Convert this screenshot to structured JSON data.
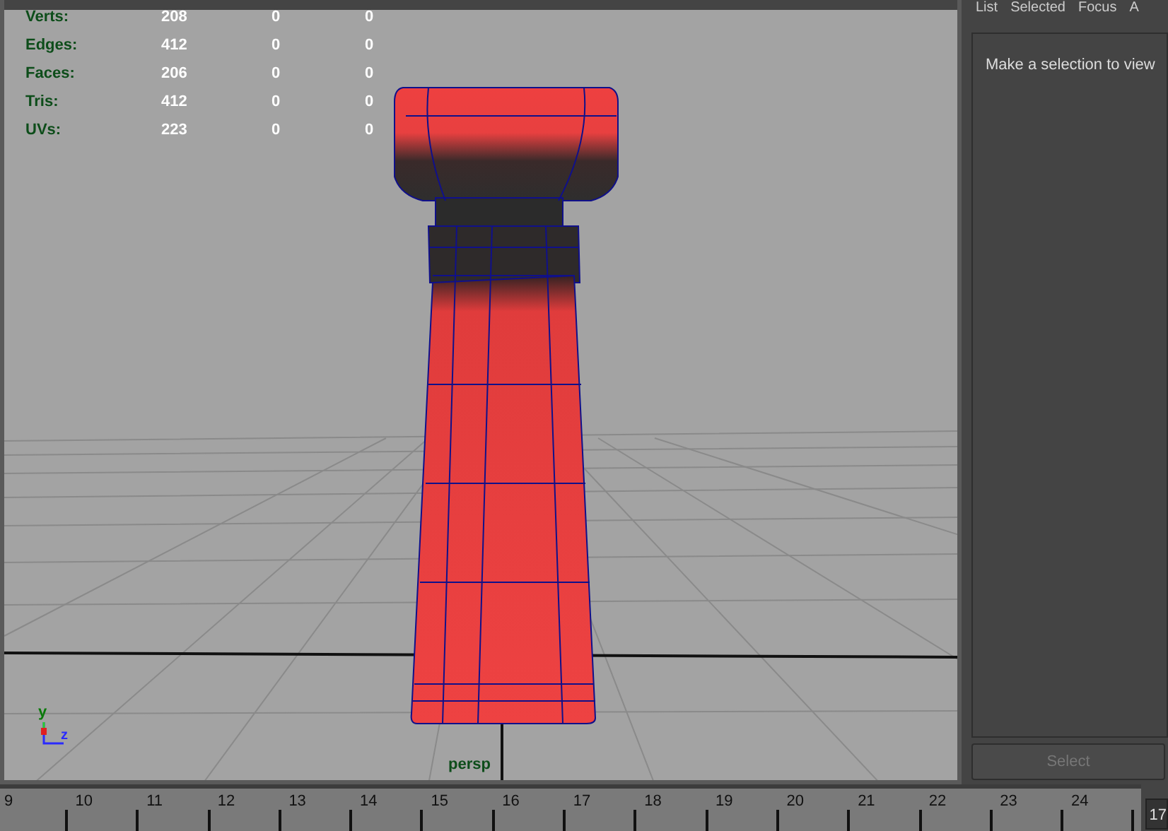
{
  "viewport": {
    "stats": [
      {
        "label": "Verts:",
        "values": [
          "208",
          "0",
          "0"
        ]
      },
      {
        "label": "Edges:",
        "values": [
          "412",
          "0",
          "0"
        ]
      },
      {
        "label": "Faces:",
        "values": [
          "206",
          "0",
          "0"
        ]
      },
      {
        "label": "Tris:",
        "values": [
          "412",
          "0",
          "0"
        ]
      },
      {
        "label": "UVs:",
        "values": [
          "223",
          "0",
          "0"
        ]
      }
    ],
    "axis_labels": [
      "y",
      "z"
    ],
    "camera": "persp"
  },
  "panel": {
    "menu": [
      "List",
      "Selected",
      "Focus",
      "A"
    ],
    "message": "Make a selection to view",
    "button": {
      "label": "Select",
      "disabled": true
    }
  },
  "timeline": {
    "ticks": [
      "9",
      "10",
      "11",
      "12",
      "13",
      "14",
      "15",
      "16",
      "17",
      "18",
      "19",
      "20",
      "21",
      "22",
      "23",
      "24"
    ],
    "current_frame": "17"
  }
}
